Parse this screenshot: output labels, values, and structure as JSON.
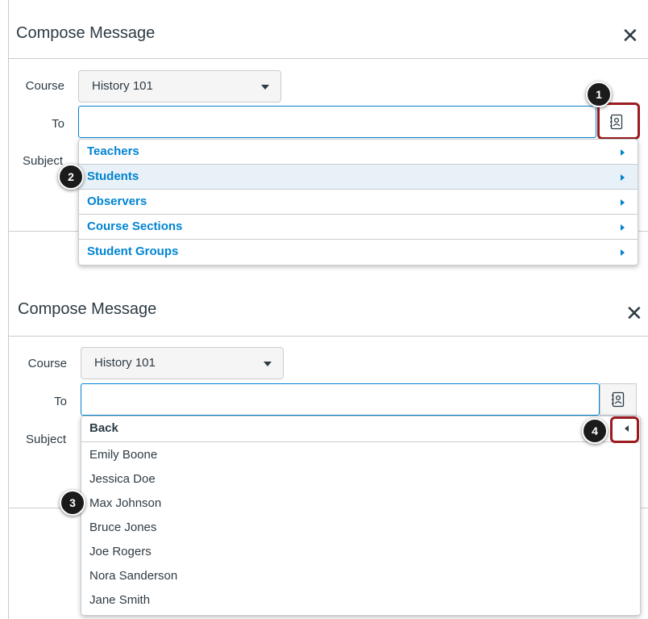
{
  "panel1": {
    "title": "Compose Message",
    "close": "✕",
    "course_label": "Course",
    "course_value": "History 101",
    "to_label": "To",
    "subject_label": "Subject",
    "recipient_categories": [
      {
        "label": "Teachers"
      },
      {
        "label": "Students"
      },
      {
        "label": "Observers"
      },
      {
        "label": "Course Sections"
      },
      {
        "label": "Student Groups"
      }
    ]
  },
  "panel2": {
    "title": "Compose Message",
    "close": "✕",
    "course_label": "Course",
    "course_value": "History 101",
    "to_label": "To",
    "subject_label": "Subject",
    "back_label": "Back",
    "students": [
      "Emily Boone",
      "Jessica Doe",
      "Max Johnson",
      "Bruce Jones",
      "Joe Rogers",
      "Nora Sanderson",
      "Jane Smith"
    ]
  },
  "badges": [
    "1",
    "2",
    "3",
    "4"
  ],
  "colors": {
    "link": "#0084d1",
    "highlight": "#9b1b20",
    "badge": "#1b1b1b",
    "selected_row": "#e8f1f7"
  }
}
